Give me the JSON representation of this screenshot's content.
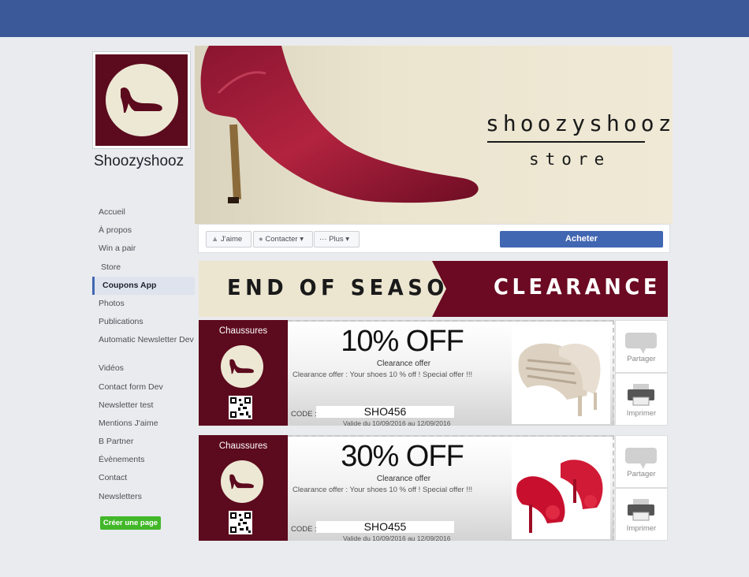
{
  "page": {
    "name": "Shoozyshooz",
    "brand_title": "shoozyshooz",
    "brand_subtitle": "store"
  },
  "colors": {
    "topbar": "#3b5998",
    "brand": "#5c0a1d",
    "cream": "#ece8d4",
    "buy": "#4267b2",
    "create": "#42b72a"
  },
  "nav": {
    "items": [
      {
        "label": "Accueil"
      },
      {
        "label": "À propos"
      },
      {
        "label": "Win a pair"
      },
      {
        "label": "Store"
      },
      {
        "label": "Coupons App"
      },
      {
        "label": "Photos"
      },
      {
        "label": "Publications"
      },
      {
        "label": "Automatic Newsletter Dev"
      },
      {
        "label": "Vidéos"
      },
      {
        "label": "Contact form Dev"
      },
      {
        "label": "Newsletter test"
      },
      {
        "label": "Mentions J'aime"
      },
      {
        "label": "B Partner"
      },
      {
        "label": "Évènements"
      },
      {
        "label": "Contact"
      },
      {
        "label": "Newsletters"
      }
    ],
    "create_page": "Créer une page"
  },
  "actions": {
    "like": "J'aime",
    "contact": "Contacter",
    "more": "Plus",
    "buy": "Acheter"
  },
  "banner": {
    "left": "END OF SEASON",
    "right": "CLEARANCE"
  },
  "coupons": [
    {
      "category": "Chaussures",
      "offer": "10% OFF",
      "title": "Clearance offer",
      "description": "Clearance offer : Your shoes 10 % off ! Special offer !!!",
      "code_label": "CODE :",
      "code": "SHO456",
      "validity": "Valide du 10/09/2016 au 12/09/2016",
      "share": "Partager",
      "print": "Imprimer"
    },
    {
      "category": "Chaussures",
      "offer": "30% OFF",
      "title": "Clearance offer",
      "description": "Clearance offer : Your shoes 10 % off ! Special offer !!!",
      "code_label": "CODE :",
      "code": "SHO455",
      "validity": "Valide du 10/09/2016 au 12/09/2016",
      "share": "Partager",
      "print": "Imprimer"
    }
  ]
}
